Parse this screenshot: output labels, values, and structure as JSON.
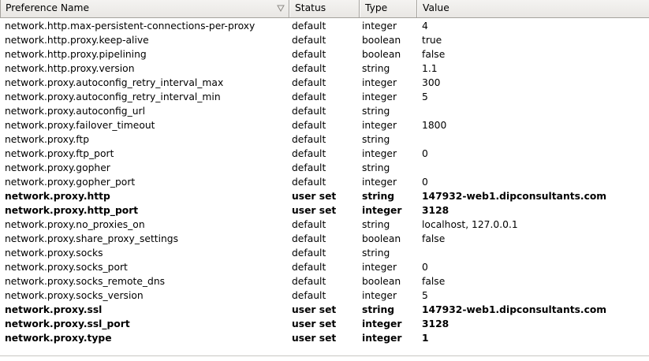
{
  "columns": {
    "name": "Preference Name",
    "status": "Status",
    "type": "Type",
    "value": "Value"
  },
  "rows": [
    {
      "name": "network.http.max-persistent-connections-per-proxy",
      "status": "default",
      "type": "integer",
      "value": "4",
      "modified": false
    },
    {
      "name": "network.http.proxy.keep-alive",
      "status": "default",
      "type": "boolean",
      "value": "true",
      "modified": false
    },
    {
      "name": "network.http.proxy.pipelining",
      "status": "default",
      "type": "boolean",
      "value": "false",
      "modified": false
    },
    {
      "name": "network.http.proxy.version",
      "status": "default",
      "type": "string",
      "value": "1.1",
      "modified": false
    },
    {
      "name": "network.proxy.autoconfig_retry_interval_max",
      "status": "default",
      "type": "integer",
      "value": "300",
      "modified": false
    },
    {
      "name": "network.proxy.autoconfig_retry_interval_min",
      "status": "default",
      "type": "integer",
      "value": "5",
      "modified": false
    },
    {
      "name": "network.proxy.autoconfig_url",
      "status": "default",
      "type": "string",
      "value": "",
      "modified": false
    },
    {
      "name": "network.proxy.failover_timeout",
      "status": "default",
      "type": "integer",
      "value": "1800",
      "modified": false
    },
    {
      "name": "network.proxy.ftp",
      "status": "default",
      "type": "string",
      "value": "",
      "modified": false
    },
    {
      "name": "network.proxy.ftp_port",
      "status": "default",
      "type": "integer",
      "value": "0",
      "modified": false
    },
    {
      "name": "network.proxy.gopher",
      "status": "default",
      "type": "string",
      "value": "",
      "modified": false
    },
    {
      "name": "network.proxy.gopher_port",
      "status": "default",
      "type": "integer",
      "value": "0",
      "modified": false
    },
    {
      "name": "network.proxy.http",
      "status": "user set",
      "type": "string",
      "value": "147932-web1.dipconsultants.com",
      "modified": true
    },
    {
      "name": "network.proxy.http_port",
      "status": "user set",
      "type": "integer",
      "value": "3128",
      "modified": true
    },
    {
      "name": "network.proxy.no_proxies_on",
      "status": "default",
      "type": "string",
      "value": "localhost, 127.0.0.1",
      "modified": false
    },
    {
      "name": "network.proxy.share_proxy_settings",
      "status": "default",
      "type": "boolean",
      "value": "false",
      "modified": false
    },
    {
      "name": "network.proxy.socks",
      "status": "default",
      "type": "string",
      "value": "",
      "modified": false
    },
    {
      "name": "network.proxy.socks_port",
      "status": "default",
      "type": "integer",
      "value": "0",
      "modified": false
    },
    {
      "name": "network.proxy.socks_remote_dns",
      "status": "default",
      "type": "boolean",
      "value": "false",
      "modified": false
    },
    {
      "name": "network.proxy.socks_version",
      "status": "default",
      "type": "integer",
      "value": "5",
      "modified": false
    },
    {
      "name": "network.proxy.ssl",
      "status": "user set",
      "type": "string",
      "value": "147932-web1.dipconsultants.com",
      "modified": true
    },
    {
      "name": "network.proxy.ssl_port",
      "status": "user set",
      "type": "integer",
      "value": "3128",
      "modified": true
    },
    {
      "name": "network.proxy.type",
      "status": "user set",
      "type": "integer",
      "value": "1",
      "modified": true
    }
  ]
}
